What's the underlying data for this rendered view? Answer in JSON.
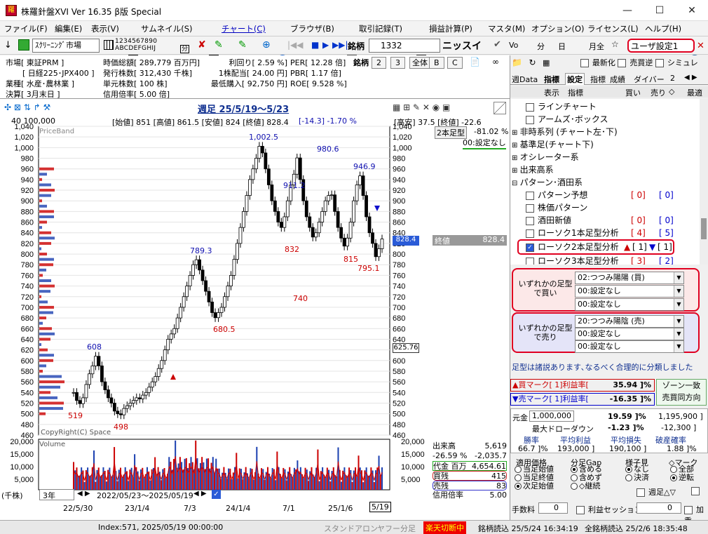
{
  "window": {
    "title": "株羅針盤XVI Ver 16.35 β版 Special",
    "min": "—",
    "max": "☐",
    "close": "✕"
  },
  "menu": [
    "ファイル(F)",
    "編集(E)",
    "表示(V)",
    "サムネイル(S)",
    "チャート(C)",
    "ブラウザ(B)",
    "取引記録(T)",
    "損益計算(P)",
    "マスタ(M)",
    "オプション(O)",
    "ライセンス(L)",
    "ヘルプ(H)"
  ],
  "toolbar": {
    "screening": "ｽｸﾘｰﾆﾝｸﾞ市場",
    "meigara_label": "銘柄",
    "code": "1332",
    "company": "ニッスイ",
    "user_setting": "ユーザ設定1",
    "digits_top": "1234567890",
    "digits_bottom": "ABCDEFGHIJ",
    "bun": "分",
    "vol": "Vo",
    "bun2": "分",
    "hi": "日",
    "getsu": "月全"
  },
  "info": {
    "col1": [
      "市場[ 東証PRM ]",
      "[ 日経225･JPX400 ]",
      "業種[ 水産･農林業 ]",
      "決算[ 3月末日 ]"
    ],
    "col2": [
      "時価総額[ 289,779 百万円]",
      "発行株数[ 312,430 千株]",
      "単元株数[ 100 株]",
      "信用倍率[ 5.00 倍]"
    ],
    "col3": [
      "利回り[ 2.59 %]",
      "1株配当[ 24.00 円]",
      "最低購入[ 92,750 円]"
    ],
    "col4": [
      "PER[ 12.28 倍]",
      "PBR[ 1.17 倍]",
      "ROE[ 9.528 %]"
    ],
    "meigara": "銘柄",
    "tabs": [
      "2",
      "3",
      "全体",
      "B",
      "C"
    ]
  },
  "chart": {
    "header": "週足 25/5/19～5/23",
    "ohlc": "[始値] 851 [高値] 861.5 [安値] 824 [終値] 828.4",
    "change": "[-14.3] -1.70 %",
    "top_left": "40 100,000",
    "right_info": "[高安] 37.5 [終値] -22.6",
    "label_2bar": "2本足型",
    "label_2bar_val": "-81.02 %",
    "label_setting": "00:設定なし",
    "label_close": "終値",
    "label_close_val": "828.4",
    "current_price": "828.4",
    "sub_price": "625.76",
    "priceband": "PriceBand",
    "copyright": "CopyRight(C) Space",
    "volume_label": "Volume",
    "y_ticks": [
      "1,040",
      "1,020",
      "1,000",
      "980",
      "960",
      "940",
      "920",
      "900",
      "880",
      "860",
      "840",
      "820",
      "800",
      "780",
      "760",
      "740",
      "720",
      "700",
      "680",
      "660",
      "640",
      "620",
      "600",
      "580",
      "560",
      "540",
      "520",
      "500",
      "480",
      "460"
    ],
    "vol_ticks": [
      "20,000",
      "15,000",
      "10,000",
      "5,000"
    ],
    "x_ticks": [
      "22/5/30",
      "23/1/4",
      "7/3",
      "24/1/4",
      "7/1",
      "25/1/6"
    ],
    "x_end": "5/19",
    "period": "3年",
    "range": "2022/05/23～2025/05/19",
    "unit": "(千株)",
    "annotations": [
      {
        "text": "1,002.5",
        "color": "blue"
      },
      {
        "text": "980.6",
        "color": "blue"
      },
      {
        "text": "946.9",
        "color": "blue"
      },
      {
        "text": "911.2",
        "color": "blue"
      },
      {
        "text": "789.3",
        "color": "blue"
      },
      {
        "text": "608",
        "color": "blue"
      },
      {
        "text": "832",
        "color": "red"
      },
      {
        "text": "815",
        "color": "red"
      },
      {
        "text": "795.1",
        "color": "red"
      },
      {
        "text": "740",
        "color": "red"
      },
      {
        "text": "680.5",
        "color": "red"
      },
      {
        "text": "519",
        "color": "red"
      },
      {
        "text": "498",
        "color": "red"
      }
    ],
    "stats": [
      [
        "出来高",
        "5,619"
      ],
      [
        "-26.59 %",
        "-2,035.7"
      ],
      [
        "代金 百万",
        "4,654.61"
      ],
      [
        "買残",
        "415"
      ],
      [
        "売残",
        "83"
      ],
      [
        "信用倍率",
        "5.00"
      ]
    ]
  },
  "chart_data": {
    "type": "candlestick",
    "x_range": [
      "2022/05/23",
      "2025/05/19"
    ],
    "ylim": [
      460,
      1040
    ],
    "weekly_close": [
      540,
      525,
      519,
      530,
      555,
      575,
      590,
      608,
      590,
      560,
      545,
      530,
      520,
      505,
      500,
      498,
      510,
      515,
      520,
      525,
      530,
      528,
      535,
      540,
      550,
      560,
      570,
      585,
      600,
      620,
      640,
      650,
      660,
      680,
      700,
      720,
      740,
      760,
      780,
      789.3,
      770,
      750,
      730,
      710,
      690,
      680.5,
      690,
      700,
      720,
      740,
      760,
      790,
      820,
      850,
      880,
      910,
      940,
      960,
      980,
      1002.5,
      990,
      960,
      930,
      900,
      880,
      860,
      850,
      870,
      900,
      930,
      950,
      980.6,
      940,
      900,
      870,
      850,
      832,
      840,
      860,
      880,
      900,
      910,
      911.2,
      880,
      850,
      830,
      815,
      830,
      860,
      900,
      930,
      946.9,
      910,
      870,
      840,
      820,
      795.1,
      810,
      828.4
    ],
    "last": {
      "open": 851,
      "high": 861.5,
      "low": 824,
      "close": 828.4,
      "change": -14.3,
      "change_pct": -1.7
    },
    "peaks": [
      1002.5,
      980.6,
      946.9,
      911.2,
      789.3,
      608
    ],
    "troughs": [
      832,
      815,
      795.1,
      740,
      680.5,
      519,
      498
    ],
    "volume_ylim": [
      0,
      20000
    ]
  },
  "right": {
    "tabs": [
      "週Data",
      "指標",
      "設定",
      "指標",
      "成績",
      "ダイバー",
      "2"
    ],
    "header": [
      "表示",
      "指標",
      "買い",
      "売り",
      "最適"
    ],
    "tree": [
      {
        "label": "ラインチャート",
        "chk": true
      },
      {
        "label": "アームズ･ボックス",
        "chk": true
      },
      {
        "label": "非時系列 (チャート左･下)",
        "exp": true
      },
      {
        "label": "基準足(チャート下)",
        "exp": true
      },
      {
        "label": "オシレーター系",
        "exp": true
      },
      {
        "label": "出来高系",
        "exp": true
      },
      {
        "label": "パターン･酒田系",
        "exp": "-"
      },
      {
        "label": "パターン予想",
        "chk": true,
        "a": "[ 0]",
        "b": "[ 0]"
      },
      {
        "label": "株価パターン",
        "chk": true
      },
      {
        "label": "酒田新値",
        "chk": true,
        "a": "[ 0]",
        "b": "[ 0]"
      },
      {
        "label": "ローソク1本足型分析",
        "chk": true,
        "a": "[ 4]",
        "b": "[ 5]"
      },
      {
        "label": "ローソク2本足型分析",
        "chk": "on",
        "a": "[ 1]",
        "b": "[ 1]"
      },
      {
        "label": "ローソク3本足型分析",
        "chk": true,
        "a": "[ 3]",
        "b": "[ 2]"
      }
    ],
    "buy_label": "いずれかの足型で買い",
    "buy_opts": [
      "02:つつみ陽陽 (買)",
      "00:設定なし",
      "00:設定なし"
    ],
    "sell_label": "いずれかの足型で売り",
    "sell_opts": [
      "20:つつみ陽陰 (売)",
      "00:設定なし",
      "00:設定なし"
    ],
    "note": "足型は諸説あります､なるべく合理的に分類しました",
    "buy_mark": "▲買マーク[ 1]利益率[",
    "buy_val": "35.94 ]%",
    "sell_mark": "▼売マーク[ 1]利益率[",
    "sell_val": "-16.35 ]%",
    "zone": "ゾーン一致",
    "zone2": "売買同方向",
    "gankin": "元金",
    "gankin_val": "1,000,000",
    "profit_pct": "19.59 ]%",
    "profit_amt": "1,195,900 ]",
    "dd_label": "最大ドローダウン",
    "dd_pct": "-1.23 ]%",
    "dd_amt": "-12,300 ]",
    "stat_hdr": [
      "勝率",
      "平均利益",
      "平均損失",
      "破産確率"
    ],
    "stat_vals": [
      "66.7 ]%",
      "193,000 ]",
      "190,100 ]",
      "1.88 ]%"
    ],
    "tekiyo": "適用価格",
    "tekiyo_opts": [
      "当足始値",
      "当足終値",
      "次足始値"
    ],
    "gap": "分足Gap",
    "gap_opts": [
      "含める",
      "含めず",
      "◇継続"
    ],
    "yosu": "様子見",
    "yosu_opts": [
      "なし",
      "決済"
    ],
    "mark": "◇マーク",
    "mark_opts": [
      "全部",
      "逆転"
    ],
    "shukei": "週足△▽",
    "tesu": "手数料",
    "tesu_val": "0",
    "rieki": "利益セッション",
    "rieki_val": "0",
    "kasan": "加重"
  },
  "status": {
    "index": "Index:571, 2025/05/19 00:00:00",
    "standalone": "スタンドアロン",
    "yahoo": "ヤフー分足",
    "rakuten": "楽天切断中",
    "read1": "銘柄読込 25/5/24 16:34:19",
    "read2": "全銘柄読込 25/2/6 18:35:48"
  }
}
